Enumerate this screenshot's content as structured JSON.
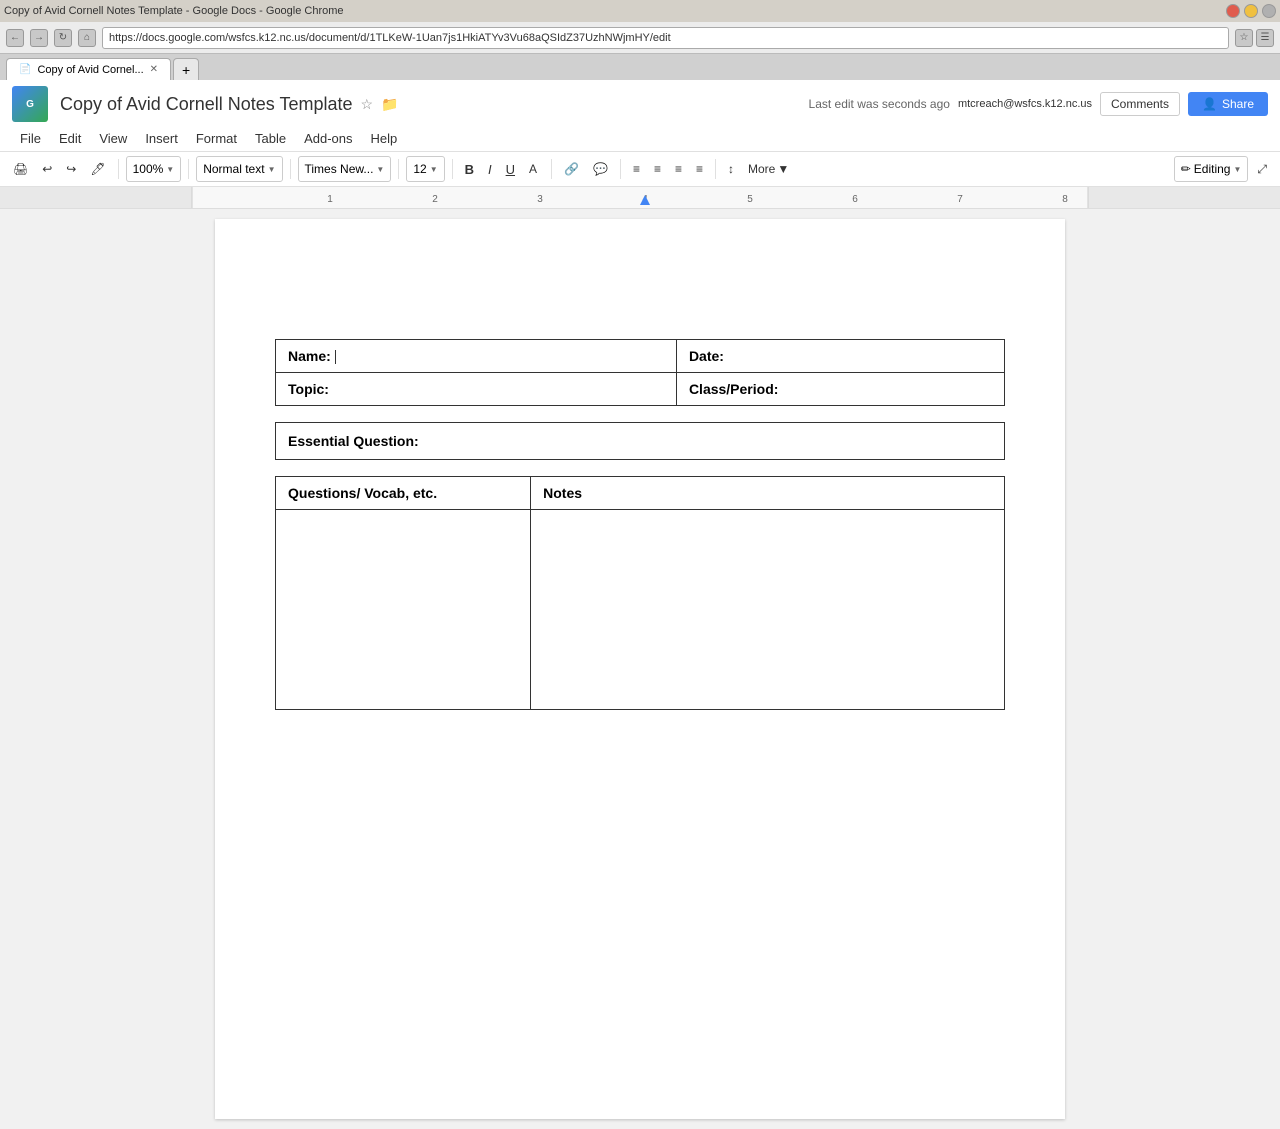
{
  "browser": {
    "address": "https://docs.google.com/wsfcs.k12.nc.us/document/d/1TLKeW-1Uan7js1HkiATYv3Vu68aQSIdZ37UzhNWjmHY/edit",
    "tab_title": "Copy of Avid Cornel...",
    "btn_close": "✕",
    "btn_min": "—",
    "btn_max": "□"
  },
  "header": {
    "title": "Copy of Avid Cornell Notes Template",
    "user": "mtcreach@wsfcs.k12.nc.us",
    "save_status": "Last edit was seconds ago",
    "comments_label": "Comments",
    "share_label": "Share"
  },
  "menu": {
    "items": [
      "File",
      "Edit",
      "View",
      "Insert",
      "Format",
      "Table",
      "Add-ons",
      "Help"
    ]
  },
  "toolbar": {
    "zoom": "100%",
    "style": "Normal text",
    "font": "Times New...",
    "size": "12",
    "bold": "B",
    "italic": "I",
    "underline": "U",
    "more": "More",
    "editing": "Editing"
  },
  "document": {
    "name_label": "Name:",
    "date_label": "Date:",
    "topic_label": "Topic:",
    "class_label": "Class/Period:",
    "essential_label": "Essential Question:",
    "col1_label": "Questions/ Vocab, etc.",
    "col2_label": "Notes"
  }
}
